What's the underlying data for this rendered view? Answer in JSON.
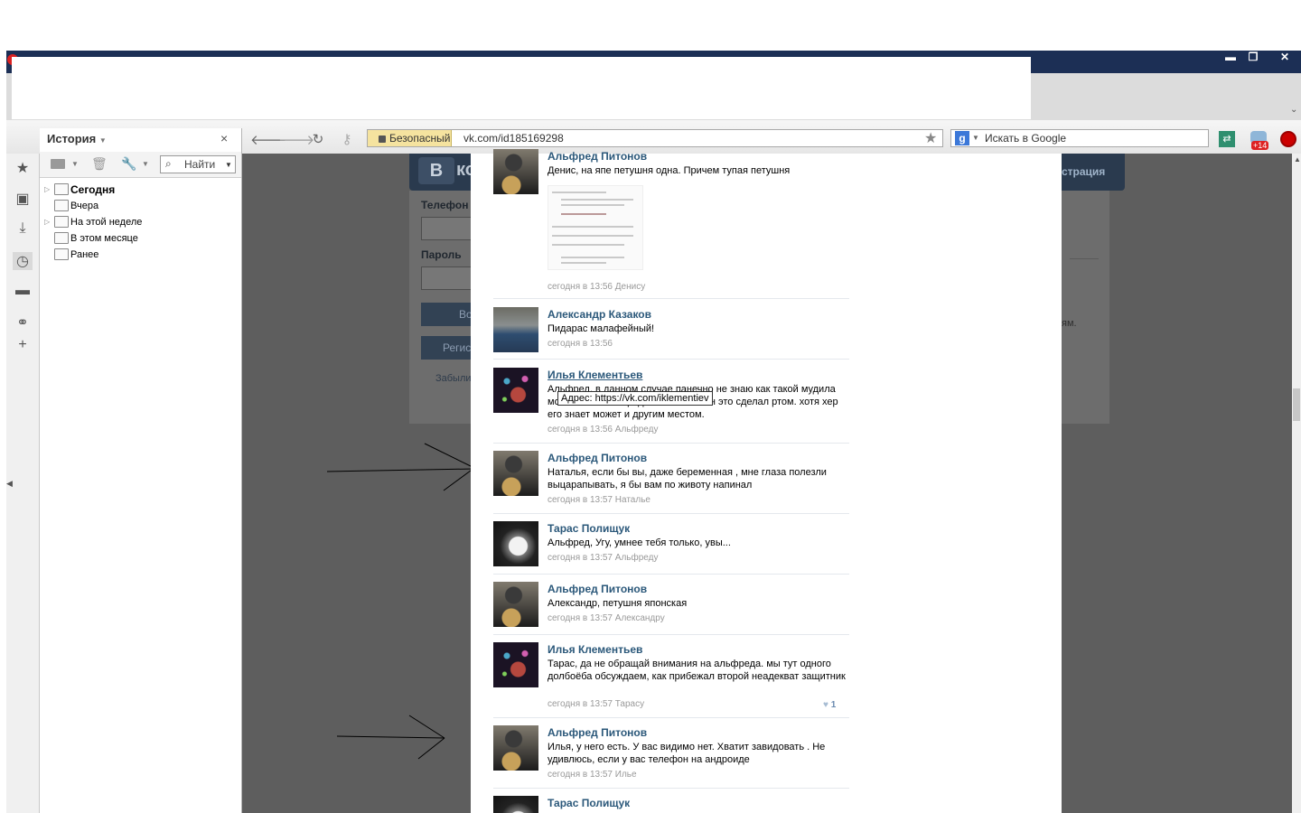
{
  "browser": {
    "window_buttons": [
      "▬",
      "❐",
      "✕"
    ],
    "security_label": "Безопасный",
    "url": "vk.com/id185169298",
    "search_placeholder": "Искать в Google",
    "badge": "+14",
    "icons": [
      "back-icon",
      "forward-icon",
      "reload-icon",
      "key-icon",
      "star-icon",
      "translate-icon",
      "notifications-icon",
      "opera-icon"
    ]
  },
  "sidebar": {
    "title": "История",
    "close": "×",
    "find_label": "Найти",
    "items": [
      {
        "label": "Сегодня",
        "bold": true,
        "expandable": true
      },
      {
        "label": "Вчера",
        "bold": false,
        "expandable": false
      },
      {
        "label": "На этой неделе",
        "bold": false,
        "expandable": true
      },
      {
        "label": "В этом месяце",
        "bold": false,
        "expandable": false
      },
      {
        "label": "Ранее",
        "bold": false,
        "expandable": false
      }
    ]
  },
  "vk_background": {
    "logo_text": "кон",
    "register": "страция",
    "phone_label": "Телефон",
    "password_label": "Пароль",
    "login_btn": "Во",
    "register_btn": "Регис",
    "forgot": "Забыли",
    "right_text": "ям."
  },
  "comments": [
    {
      "name": "Альфред Питонов",
      "text": "Денис, на япе петушня одна. Причем тупая петушня",
      "meta": "сегодня в 13:56 Денису"
    },
    {
      "name": "Александр Казаков",
      "text": "Пидарас малафейный!",
      "meta": "сегодня в 13:56"
    },
    {
      "name": "Илья Клементьев",
      "text": "Альфред, в данном случае панечно не знаю как такой мудила мог... это ты а я предположил что он это сделал ртом. хотя хер его знает может и другим местом.",
      "meta": "сегодня в 13:56 Альфреду"
    },
    {
      "name": "Альфред Питонов",
      "text": "Наталья, если бы вы, даже беременная , мне глаза полезли выцарапывать, я бы вам по животу напинал",
      "meta": "сегодня в 13:57 Наталье"
    },
    {
      "name": "Тарас Полищук",
      "text": "Альфред, Угу, умнее тебя только, увы...",
      "meta": "сегодня в 13:57 Альфреду"
    },
    {
      "name": "Альфред Питонов",
      "text": "Александр, петушня японская",
      "meta": "сегодня в 13:57 Александру"
    },
    {
      "name": "Илья Клементьев",
      "text": "Тарас, да не обращай внимания на альфреда. мы тут одного долбоёба обсуждаем, как прибежал второй неадекват защитник",
      "meta": "сегодня в 13:57 Тарасу",
      "likes": "1"
    },
    {
      "name": "Альфред Питонов",
      "text": "Илья, у него есть. У вас видимо нет. Хватит завидовать . Не удивлюсь, если у вас телефон на андроиде",
      "meta": "сегодня в 13:57 Илье"
    },
    {
      "name": "Тарас Полищук"
    }
  ],
  "tooltip": "Адрес: https://vk.com/iklementiev"
}
